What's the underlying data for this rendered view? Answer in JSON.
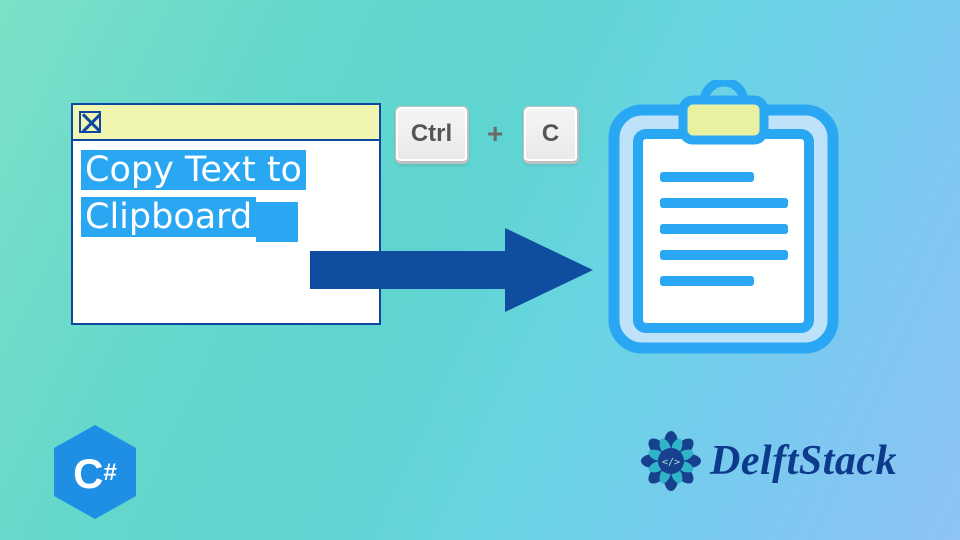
{
  "window": {
    "text_line1": "Copy Text to",
    "text_line2": "Clipboard"
  },
  "keys": {
    "ctrl": "Ctrl",
    "plus": "+",
    "c": "C"
  },
  "brand": {
    "name": "DelftStack"
  },
  "language_badge": {
    "label": "C#"
  },
  "colors": {
    "highlight": "#2aa7f3",
    "window_border": "#0d47a1",
    "titlebar": "#f0f5b0",
    "arrow": "#0f4da1",
    "clipboard_stroke": "#2aa7f3",
    "clipboard_body": "#ffffff",
    "clipboard_back": "#bfe2fb",
    "clip_metal": "#e9f0a0",
    "brand_text": "#0d3b8c",
    "csharp_hex": "#1f8fe6"
  }
}
